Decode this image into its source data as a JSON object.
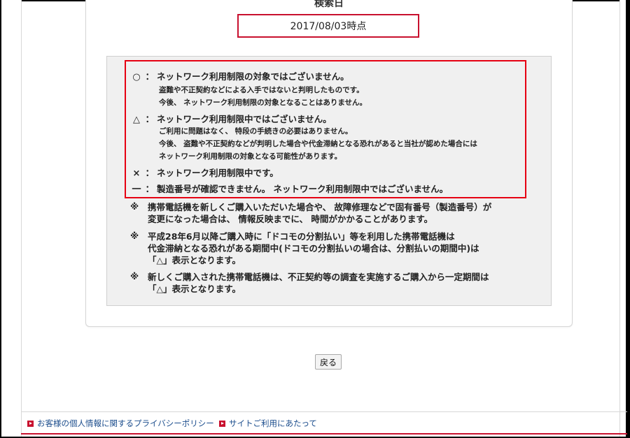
{
  "search": {
    "heading": "検索日",
    "date_value": "2017/08/03時点"
  },
  "legend": [
    {
      "symbol": "○",
      "status": "ネットワーク利用制限の対象ではございません。",
      "details": [
        "盗難や不正契約などによる入手ではないと判明したものです。",
        "今後、 ネットワーク利用制限の対象となることはありません。"
      ]
    },
    {
      "symbol": "△",
      "status": "ネットワーク利用制限中ではございません。",
      "details": [
        "ご利用に問題はなく、 特段の手続きの必要はありません。",
        "今後、 盗難や不正契約などが判明した場合や代金滞納となる恐れがあると当社が認めた場合には",
        "ネットワーク利用制限の対象となる可能性があります。"
      ]
    },
    {
      "symbol": "×",
      "status": "ネットワーク利用制限中です。",
      "details": []
    },
    {
      "symbol": "一",
      "status": "製造番号が確認できません。 ネットワーク利用制限中ではございません。",
      "details": []
    }
  ],
  "separator": "：",
  "notes": [
    {
      "mark": "※",
      "lines": [
        "携帯電話機を新しくご購入いただいた場合や、 故障修理などで固有番号（製造番号）が",
        "変更になった場合は、 情報反映までに、 時間がかかることがあります。"
      ]
    },
    {
      "mark": "※",
      "lines": [
        "平成28年6月以降ご購入時に「ドコモの分割払い」等を利用した携帯電話機は",
        "代金滞納となる恐れがある期間中(ドコモの分割払いの場合は、分割払いの期間中)は",
        "「△」表示となります。"
      ]
    },
    {
      "mark": "※",
      "lines": [
        "新しくご購入された携帯電話機は、不正契約等の調査を実施するご購入から一定期間は",
        "「△」表示となります。"
      ]
    }
  ],
  "back_button_label": "戻る",
  "footer": {
    "links": [
      {
        "label": "お客様の個人情報に関するプライバシーポリシー"
      },
      {
        "label": "サイトご利用にあたって"
      }
    ]
  },
  "colors": {
    "accent_red": "#c8102e",
    "highlight_red": "#e60012",
    "link_blue": "#1a4c8c",
    "panel_gray": "#f0f0f0"
  }
}
